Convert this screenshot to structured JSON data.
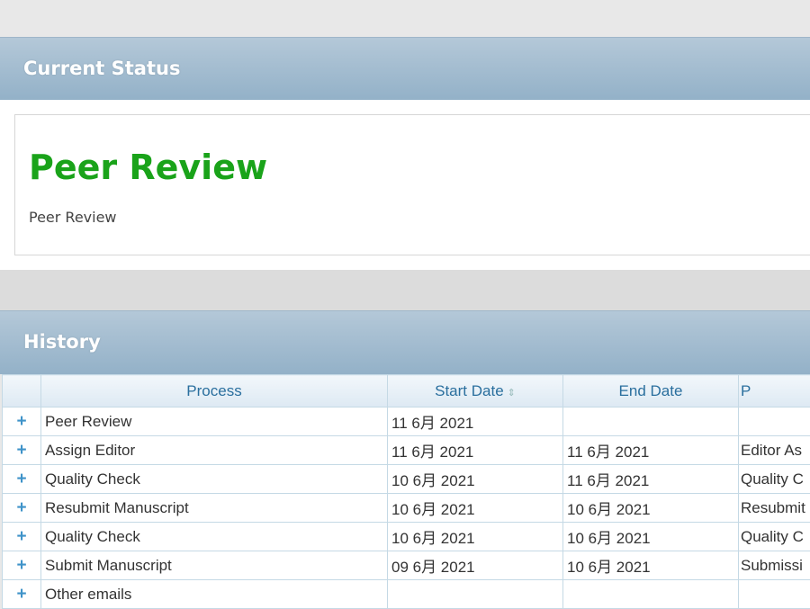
{
  "current_status": {
    "title": "Current Status",
    "status": "Peer Review",
    "description": "Peer Review",
    "status_color": "#1aa31a"
  },
  "history": {
    "title": "History",
    "columns": [
      "Process",
      "Start Date",
      "End Date",
      "P"
    ],
    "rows": [
      {
        "process": "Peer Review",
        "start": "11 6月 2021",
        "end": "",
        "extra": ""
      },
      {
        "process": "Assign Editor",
        "start": "11 6月 2021",
        "end": "11 6月 2021",
        "extra": "Editor As"
      },
      {
        "process": "Quality Check",
        "start": "10 6月 2021",
        "end": "11 6月 2021",
        "extra": "Quality C"
      },
      {
        "process": "Resubmit Manuscript",
        "start": "10 6月 2021",
        "end": "10 6月 2021",
        "extra": "Resubmit"
      },
      {
        "process": "Quality Check",
        "start": "10 6月 2021",
        "end": "10 6月 2021",
        "extra": "Quality C"
      },
      {
        "process": "Submit Manuscript",
        "start": "09 6月 2021",
        "end": "10 6月 2021",
        "extra": "Submissi"
      },
      {
        "process": "Other emails",
        "start": "",
        "end": "",
        "extra": ""
      }
    ],
    "expand_symbol": "+",
    "sort_symbol": "⇕"
  }
}
